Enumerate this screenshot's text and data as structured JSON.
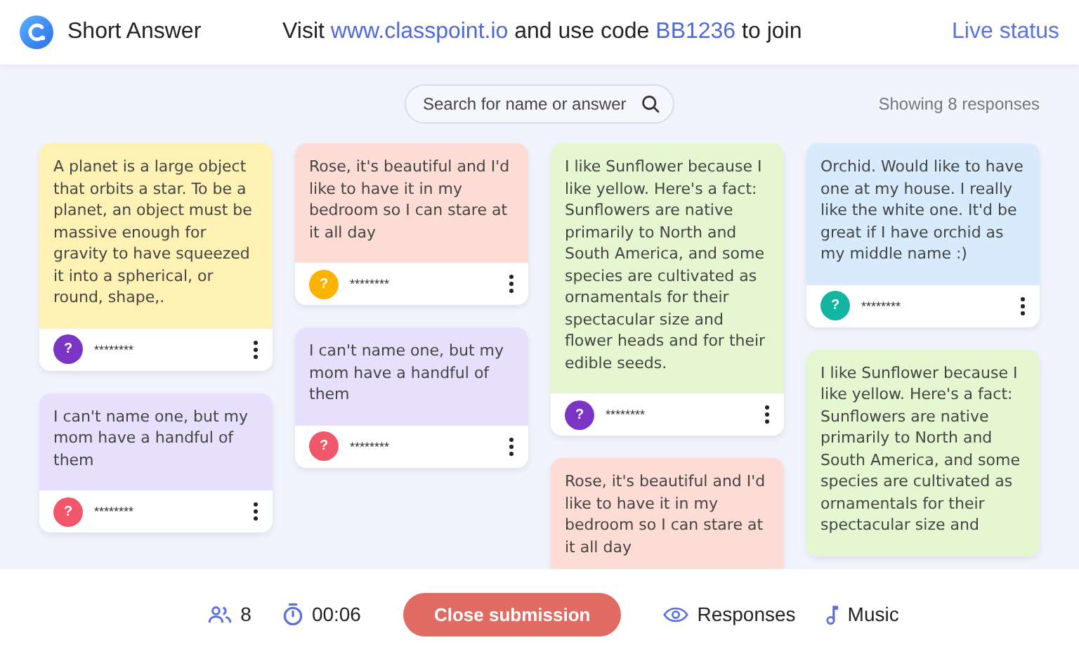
{
  "header": {
    "title": "Short Answer",
    "join": {
      "prefix": "Visit ",
      "site": "www.classpoint.io",
      "middle": " and use code ",
      "code": "BB1236",
      "suffix": " to join"
    },
    "live_status": "Live status"
  },
  "search": {
    "placeholder": "Search for name or answer"
  },
  "showing": "Showing 8 responses",
  "columns": [
    [
      {
        "text": "A planet is a large object that orbits a star. To be a planet, an object must be massive enough for gravity to have squeezed it into a spherical, or round, shape,.",
        "color": "#fdf2b3",
        "avatar": {
          "symbol": "?",
          "color": "#7b35c4"
        },
        "name": "********"
      },
      {
        "text": "I can't name one, but my mom have a handful of them",
        "color": "#e7e0fd",
        "avatar": {
          "symbol": "?",
          "color": "#f2566b"
        },
        "name": "********"
      }
    ],
    [
      {
        "text": "Rose, it's beautiful and I'd like to have it in my bedroom so I can stare at it all day",
        "color": "#fddcd6",
        "avatar": {
          "symbol": "?",
          "color": "#fbb300"
        },
        "name": "********"
      },
      {
        "text": "I can't name one, but my mom have a handful of them",
        "color": "#e7e0fd",
        "avatar": {
          "symbol": "?",
          "color": "#f2566b"
        },
        "name": "********"
      }
    ],
    [
      {
        "text": "I like Sunflower because I like yellow. Here's a fact: Sunflowers are native primarily to North and South America, and some species are cultivated as ornamentals for their spectacular size and flower heads and for their edible seeds.",
        "color": "#e5f7d0",
        "avatar": {
          "symbol": "?",
          "color": "#7b35c4"
        },
        "name": "********"
      },
      {
        "text": "Rose, it's beautiful and I'd like to have it in my bedroom so I can stare at it all day",
        "color": "#fddcd6"
      }
    ],
    [
      {
        "text": "Orchid. Would like to have one at my house. I really like the white one. It'd be great if I have orchid as my middle name :)",
        "color": "#d7ebfd",
        "avatar": {
          "symbol": "?",
          "color": "#13b5a1"
        },
        "name": "********"
      },
      {
        "text": "I like Sunflower because I like yellow. Here's a fact: Sunflowers are native primarily to North and South America, and some species are cultivated as ornamentals for their spectacular size and",
        "color": "#e5f7d0"
      }
    ]
  ],
  "footer": {
    "participants": "8",
    "timer": "00:06",
    "close_button": "Close submission",
    "responses": "Responses",
    "music": "Music"
  }
}
